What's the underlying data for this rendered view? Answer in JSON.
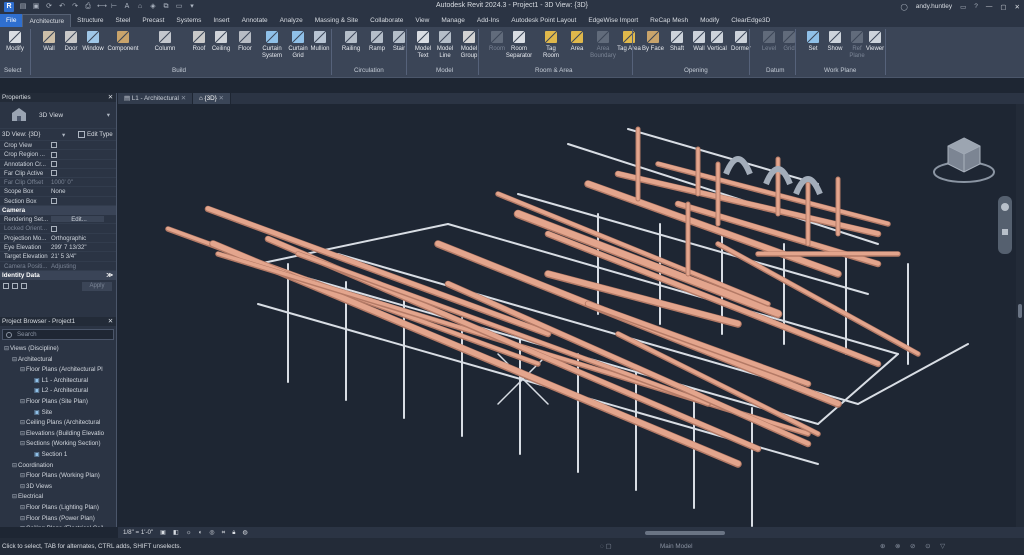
{
  "titlebar": {
    "app_title": "Autodesk Revit 2024.3 - Project1 - 3D View: {3D}",
    "user": "andy.huntley",
    "help": "?"
  },
  "ribbon_tabs": [
    "File",
    "Architecture",
    "Structure",
    "Steel",
    "Precast",
    "Systems",
    "Insert",
    "Annotate",
    "Analyze",
    "Massing & Site",
    "Collaborate",
    "View",
    "Manage",
    "Add-Ins",
    "Autodesk Point Layout",
    "EdgeWise Import",
    "ReCap Mesh",
    "Modify",
    "ClearEdge3D"
  ],
  "ribbon": {
    "buttons": [
      {
        "label": "Modify",
        "icon": "cursor-icon"
      },
      {
        "label": "Wall",
        "icon": "wall-icon"
      },
      {
        "label": "Door",
        "icon": "door-icon"
      },
      {
        "label": "Window",
        "icon": "window-icon"
      },
      {
        "label": "Component",
        "icon": "component-icon"
      },
      {
        "label": "Column",
        "icon": "column-icon"
      },
      {
        "label": "Roof",
        "icon": "roof-icon"
      },
      {
        "label": "Ceiling",
        "icon": "ceiling-icon"
      },
      {
        "label": "Floor",
        "icon": "floor-icon"
      },
      {
        "label": "Curtain System",
        "icon": "curtain-system-icon"
      },
      {
        "label": "Curtain Grid",
        "icon": "curtain-grid-icon"
      },
      {
        "label": "Mullion",
        "icon": "mullion-icon"
      },
      {
        "label": "Railing",
        "icon": "railing-icon"
      },
      {
        "label": "Ramp",
        "icon": "ramp-icon"
      },
      {
        "label": "Stair",
        "icon": "stair-icon"
      },
      {
        "label": "Model Text",
        "icon": "model-text-icon"
      },
      {
        "label": "Model Line",
        "icon": "model-line-icon"
      },
      {
        "label": "Model Group",
        "icon": "model-group-icon"
      },
      {
        "label": "Room",
        "icon": "room-icon"
      },
      {
        "label": "Room Separator",
        "icon": "room-separator-icon"
      },
      {
        "label": "Tag Room",
        "icon": "tag-room-icon"
      },
      {
        "label": "Area",
        "icon": "area-icon"
      },
      {
        "label": "Area Boundary",
        "icon": "area-boundary-icon"
      },
      {
        "label": "Tag Area",
        "icon": "tag-area-icon"
      },
      {
        "label": "By Face",
        "icon": "by-face-icon"
      },
      {
        "label": "Shaft",
        "icon": "shaft-icon"
      },
      {
        "label": "Wall",
        "icon": "wall-opening-icon"
      },
      {
        "label": "Vertical",
        "icon": "vertical-opening-icon"
      },
      {
        "label": "Dormer",
        "icon": "dormer-icon"
      },
      {
        "label": "Level",
        "icon": "level-icon"
      },
      {
        "label": "Grid",
        "icon": "grid-icon"
      },
      {
        "label": "Set",
        "icon": "set-icon"
      },
      {
        "label": "Show",
        "icon": "show-icon"
      },
      {
        "label": "Ref Plane",
        "icon": "ref-plane-icon"
      },
      {
        "label": "Viewer",
        "icon": "viewer-icon"
      }
    ],
    "panels": [
      "Select",
      "Build",
      "Circulation",
      "Model",
      "Room & Area",
      "Opening",
      "Datum",
      "Work Plane"
    ]
  },
  "view_tabs": [
    "L1 - Architectural",
    "{3D}"
  ],
  "properties": {
    "title": "Properties",
    "type_name": "3D View",
    "selector": "3D View: {3D}",
    "edit_type": "Edit Type",
    "rows": [
      {
        "k": "Crop View",
        "v": ""
      },
      {
        "k": "Crop Region ...",
        "v": ""
      },
      {
        "k": "Annotation Cr...",
        "v": ""
      },
      {
        "k": "Far Clip Active",
        "v": ""
      },
      {
        "k": "Far Clip Offset",
        "v": "1000'  0\""
      },
      {
        "k": "Scope Box",
        "v": "None"
      },
      {
        "k": "Section Box",
        "v": ""
      }
    ],
    "camera_group": "Camera",
    "camera_rows": [
      {
        "k": "Rendering Set...",
        "v": "Edit..."
      },
      {
        "k": "Locked Orient...",
        "v": ""
      },
      {
        "k": "Projection Mo...",
        "v": "Orthographic"
      },
      {
        "k": "Eye Elevation",
        "v": "299'  7 13/32\""
      },
      {
        "k": "Target Elevation",
        "v": "21'  5 3/4\""
      },
      {
        "k": "Camera Positi...",
        "v": "Adjusting"
      }
    ],
    "identity_group": "Identity Data",
    "apply": "Apply"
  },
  "browser": {
    "title": "Project Browser - Project1",
    "search_placeholder": "Search",
    "nodes": [
      {
        "label": "Views (Discipline)",
        "depth": 0
      },
      {
        "label": "Architectural",
        "depth": 1
      },
      {
        "label": "Floor Plans (Architectural Pl",
        "depth": 2
      },
      {
        "label": "L1 - Architectural",
        "depth": 3
      },
      {
        "label": "L2 - Architectural",
        "depth": 3
      },
      {
        "label": "Floor Plans (Site Plan)",
        "depth": 2
      },
      {
        "label": "Site",
        "depth": 3
      },
      {
        "label": "Ceiling Plans (Architectural",
        "depth": 2
      },
      {
        "label": "Elevations (Building Elevatio",
        "depth": 2
      },
      {
        "label": "Sections (Working Section)",
        "depth": 2
      },
      {
        "label": "Section 1",
        "depth": 3
      },
      {
        "label": "Coordination",
        "depth": 1
      },
      {
        "label": "Floor Plans (Working Plan)",
        "depth": 2
      },
      {
        "label": "3D Views",
        "depth": 2
      },
      {
        "label": "Electrical",
        "depth": 1
      },
      {
        "label": "Floor Plans (Lighting Plan)",
        "depth": 2
      },
      {
        "label": "Floor Plans (Power Plan)",
        "depth": 2
      },
      {
        "label": "Ceiling Plans (Electrical Ceil",
        "depth": 2
      }
    ]
  },
  "view_controls": {
    "scale": "1/8\" = 1'-0\""
  },
  "status": {
    "hint": "Click to select, TAB for alternates, CTRL adds, SHIFT unselects.",
    "main_model": "Main Model"
  }
}
